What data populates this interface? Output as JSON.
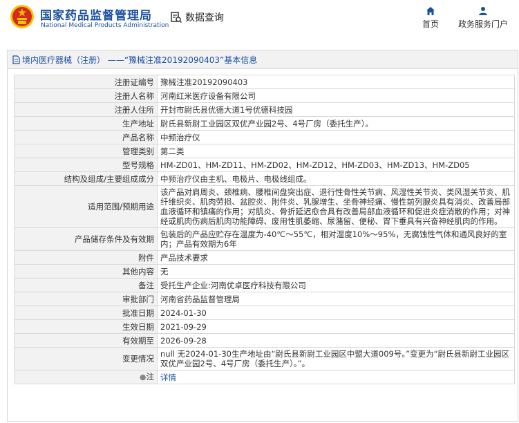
{
  "header": {
    "logo_cn": "国家药品监督管理局",
    "logo_en": "National Medical Products Administration",
    "data_query": "数据查询",
    "nav_home": "首页",
    "nav_portal": "政务服务门户"
  },
  "colors": {
    "brand_blue": "#1b4fa0",
    "emblem_red": "#d42a20",
    "emblem_gold": "#f5c400",
    "label_bg": "#f2f2f2"
  },
  "panel": {
    "title_prefix": "境内医疗器械（注册） —— ",
    "title_main": "“豫械注准20192090403”基本信息"
  },
  "rows": [
    {
      "label": "注册证编号",
      "value": "豫械注准20192090403"
    },
    {
      "label": "注册人名称",
      "value": "河南红米医疗设备有限公司"
    },
    {
      "label": "注册人住所",
      "value": "开封市尉氏县优德大道1号优德科技园"
    },
    {
      "label": "生产地址",
      "value": "尉氏县新尉工业园区双优产业园2号、4号厂房（委托生产）。"
    },
    {
      "label": "产品名称",
      "value": "中频治疗仪"
    },
    {
      "label": "管理类别",
      "value": "第二类"
    },
    {
      "label": "型号规格",
      "value": "HM-ZD01、HM-ZD11、HM-ZD02、HM-ZD12、HM-ZD03、HM-ZD13、HM-ZD05"
    },
    {
      "label": "结构及组成/主要组成成分",
      "value": "中频治疗仪由主机、电极片、电极线组成。"
    },
    {
      "label": "适用范围/预期用途",
      "value": "该产品对肩周炎、颈椎病、腰椎间盘突出症、退行性骨性关节病、风湿性关节炎、类风湿关节炎、肌纤维织炎、肌肉劳损、盆腔炎、附件炎、乳腺增生、坐骨神经痛、慢性前列腺炎具有消炎、改善局部血液循环和镇痛的作用；对肌炎、骨折延迟愈合具有改善局部血液循环和促进炎症消散的作用；对神经或肌肉伤病后肌肉功能障碍、废用性肌萎缩、尿潴留、便秘、胃下垂具有兴奋神经肌肉的作用。"
    },
    {
      "label": "产品储存条件及有效期",
      "value": "包装后的产品应贮存在温度为-40℃～55℃，相对湿度10%～95%，无腐蚀性气体和通风良好的室内；产品有效期为6年"
    },
    {
      "label": "附件",
      "value": "产品技术要求"
    },
    {
      "label": "其他内容",
      "value": "无"
    },
    {
      "label": "备注",
      "value": "受托生产企业:河南优卓医疗科技有限公司"
    },
    {
      "label": "审批部门",
      "value": "河南省药品监督管理局"
    },
    {
      "label": "批准日期",
      "value": "2024-01-30"
    },
    {
      "label": "生效日期",
      "value": "2021-09-29"
    },
    {
      "label": "有效期至",
      "value": "2026-09-28"
    },
    {
      "label": "变更情况",
      "value": "null 无2024-01-30生产地址由“尉氏县新尉工业园区中盟大道009号。”变更为“尉氏县新尉工业园区双优产业园2号、4号厂房（委托生产）。”。"
    }
  ],
  "note": {
    "label": "注",
    "link": "详情"
  }
}
